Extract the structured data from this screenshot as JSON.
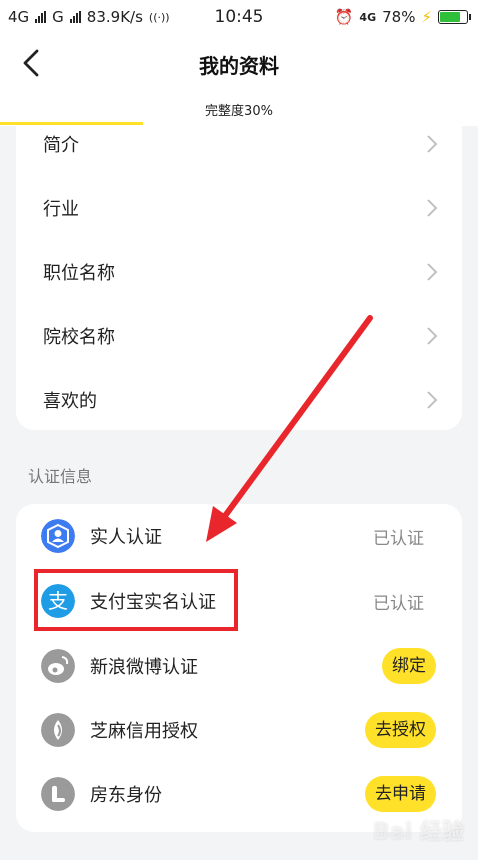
{
  "status_bar": {
    "network1": "4G",
    "network2": "G",
    "speed": "83.9K/s",
    "time": "10:45",
    "network3": "4G",
    "battery": "78%",
    "battery_level": 0.78
  },
  "header": {
    "title": "我的资料",
    "progress_label": "完整度30%",
    "progress": 0.3
  },
  "profile_items": [
    {
      "label": "简介"
    },
    {
      "label": "行业"
    },
    {
      "label": "职位名称"
    },
    {
      "label": "院校名称"
    },
    {
      "label": "喜欢的"
    }
  ],
  "auth_section": {
    "title": "认证信息",
    "items": [
      {
        "label": "实人认证",
        "status": "已认证",
        "icon": "person-verify-icon"
      },
      {
        "label": "支付宝实名认证",
        "status": "已认证",
        "icon": "alipay-icon"
      },
      {
        "label": "新浪微博认证",
        "action": "绑定",
        "icon": "weibo-icon"
      },
      {
        "label": "芝麻信用授权",
        "action": "去授权",
        "icon": "sesame-credit-icon"
      },
      {
        "label": "房东身份",
        "action": "去申请",
        "icon": "landlord-icon"
      }
    ]
  },
  "watermark": "Bai 经验",
  "colors": {
    "accent": "#ffe12a",
    "highlight": "#e8262b",
    "background": "#f3f4f6"
  }
}
